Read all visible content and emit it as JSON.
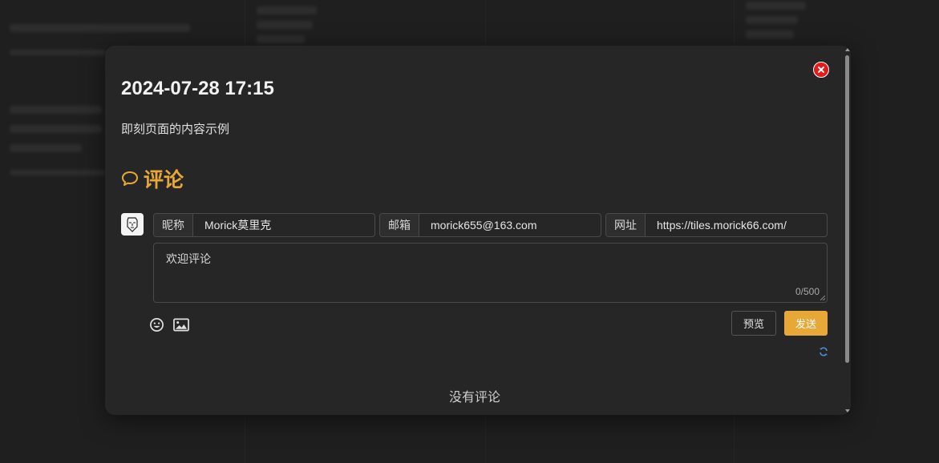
{
  "moment": {
    "time": "2024-07-28 17:15",
    "content": "即刻页面的内容示例"
  },
  "comments": {
    "heading": "评论",
    "form": {
      "nickname_label": "昵称",
      "nickname_value": "Morick莫里克",
      "email_label": "邮箱",
      "email_value": "morick655@163.com",
      "url_label": "网址",
      "url_value": "https://tiles.morick66.com/",
      "textarea_placeholder": "欢迎评论",
      "counter": "0/500",
      "preview_label": "预览",
      "send_label": "发送"
    },
    "empty_text": "没有评论"
  },
  "colors": {
    "accent": "#e8a838",
    "close": "#e41b1b",
    "refresh": "#4a90d9",
    "modal_bg": "#262626"
  },
  "icons": [
    "close-icon",
    "comment-bubble-icon",
    "emoji-icon",
    "image-icon",
    "refresh-icon",
    "avatar"
  ]
}
